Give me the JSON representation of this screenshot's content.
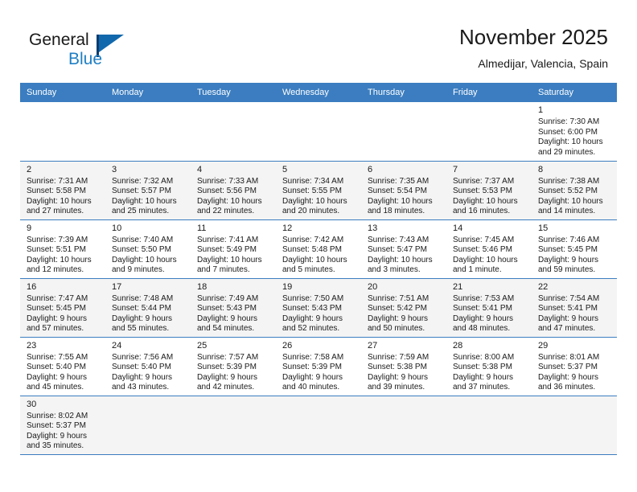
{
  "brand": {
    "name_part1": "General",
    "name_part2": "Blue",
    "logo_icon": "flag-triangle-icon"
  },
  "header": {
    "title": "November 2025",
    "subtitle": "Almedijar, Valencia, Spain"
  },
  "colors": {
    "header_blue": "#3b7dc0",
    "brand_blue": "#1f7fc4",
    "alt_row": "#f4f4f4",
    "text": "#1a1a1a"
  },
  "weekday_headers": [
    "Sunday",
    "Monday",
    "Tuesday",
    "Wednesday",
    "Thursday",
    "Friday",
    "Saturday"
  ],
  "labels": {
    "sunrise_prefix": "Sunrise: ",
    "sunset_prefix": "Sunset: ",
    "daylight_prefix": "Daylight: "
  },
  "weeks": [
    {
      "alt": false,
      "days": [
        {
          "empty": true
        },
        {
          "empty": true
        },
        {
          "empty": true
        },
        {
          "empty": true
        },
        {
          "empty": true
        },
        {
          "empty": true
        },
        {
          "empty": false,
          "day": "1",
          "sunrise": "Sunrise: 7:30 AM",
          "sunset": "Sunset: 6:00 PM",
          "daylight_line1": "Daylight: 10 hours",
          "daylight_line2": "and 29 minutes."
        }
      ]
    },
    {
      "alt": true,
      "days": [
        {
          "empty": false,
          "day": "2",
          "sunrise": "Sunrise: 7:31 AM",
          "sunset": "Sunset: 5:58 PM",
          "daylight_line1": "Daylight: 10 hours",
          "daylight_line2": "and 27 minutes."
        },
        {
          "empty": false,
          "day": "3",
          "sunrise": "Sunrise: 7:32 AM",
          "sunset": "Sunset: 5:57 PM",
          "daylight_line1": "Daylight: 10 hours",
          "daylight_line2": "and 25 minutes."
        },
        {
          "empty": false,
          "day": "4",
          "sunrise": "Sunrise: 7:33 AM",
          "sunset": "Sunset: 5:56 PM",
          "daylight_line1": "Daylight: 10 hours",
          "daylight_line2": "and 22 minutes."
        },
        {
          "empty": false,
          "day": "5",
          "sunrise": "Sunrise: 7:34 AM",
          "sunset": "Sunset: 5:55 PM",
          "daylight_line1": "Daylight: 10 hours",
          "daylight_line2": "and 20 minutes."
        },
        {
          "empty": false,
          "day": "6",
          "sunrise": "Sunrise: 7:35 AM",
          "sunset": "Sunset: 5:54 PM",
          "daylight_line1": "Daylight: 10 hours",
          "daylight_line2": "and 18 minutes."
        },
        {
          "empty": false,
          "day": "7",
          "sunrise": "Sunrise: 7:37 AM",
          "sunset": "Sunset: 5:53 PM",
          "daylight_line1": "Daylight: 10 hours",
          "daylight_line2": "and 16 minutes."
        },
        {
          "empty": false,
          "day": "8",
          "sunrise": "Sunrise: 7:38 AM",
          "sunset": "Sunset: 5:52 PM",
          "daylight_line1": "Daylight: 10 hours",
          "daylight_line2": "and 14 minutes."
        }
      ]
    },
    {
      "alt": false,
      "days": [
        {
          "empty": false,
          "day": "9",
          "sunrise": "Sunrise: 7:39 AM",
          "sunset": "Sunset: 5:51 PM",
          "daylight_line1": "Daylight: 10 hours",
          "daylight_line2": "and 12 minutes."
        },
        {
          "empty": false,
          "day": "10",
          "sunrise": "Sunrise: 7:40 AM",
          "sunset": "Sunset: 5:50 PM",
          "daylight_line1": "Daylight: 10 hours",
          "daylight_line2": "and 9 minutes."
        },
        {
          "empty": false,
          "day": "11",
          "sunrise": "Sunrise: 7:41 AM",
          "sunset": "Sunset: 5:49 PM",
          "daylight_line1": "Daylight: 10 hours",
          "daylight_line2": "and 7 minutes."
        },
        {
          "empty": false,
          "day": "12",
          "sunrise": "Sunrise: 7:42 AM",
          "sunset": "Sunset: 5:48 PM",
          "daylight_line1": "Daylight: 10 hours",
          "daylight_line2": "and 5 minutes."
        },
        {
          "empty": false,
          "day": "13",
          "sunrise": "Sunrise: 7:43 AM",
          "sunset": "Sunset: 5:47 PM",
          "daylight_line1": "Daylight: 10 hours",
          "daylight_line2": "and 3 minutes."
        },
        {
          "empty": false,
          "day": "14",
          "sunrise": "Sunrise: 7:45 AM",
          "sunset": "Sunset: 5:46 PM",
          "daylight_line1": "Daylight: 10 hours",
          "daylight_line2": "and 1 minute."
        },
        {
          "empty": false,
          "day": "15",
          "sunrise": "Sunrise: 7:46 AM",
          "sunset": "Sunset: 5:45 PM",
          "daylight_line1": "Daylight: 9 hours",
          "daylight_line2": "and 59 minutes."
        }
      ]
    },
    {
      "alt": true,
      "days": [
        {
          "empty": false,
          "day": "16",
          "sunrise": "Sunrise: 7:47 AM",
          "sunset": "Sunset: 5:45 PM",
          "daylight_line1": "Daylight: 9 hours",
          "daylight_line2": "and 57 minutes."
        },
        {
          "empty": false,
          "day": "17",
          "sunrise": "Sunrise: 7:48 AM",
          "sunset": "Sunset: 5:44 PM",
          "daylight_line1": "Daylight: 9 hours",
          "daylight_line2": "and 55 minutes."
        },
        {
          "empty": false,
          "day": "18",
          "sunrise": "Sunrise: 7:49 AM",
          "sunset": "Sunset: 5:43 PM",
          "daylight_line1": "Daylight: 9 hours",
          "daylight_line2": "and 54 minutes."
        },
        {
          "empty": false,
          "day": "19",
          "sunrise": "Sunrise: 7:50 AM",
          "sunset": "Sunset: 5:43 PM",
          "daylight_line1": "Daylight: 9 hours",
          "daylight_line2": "and 52 minutes."
        },
        {
          "empty": false,
          "day": "20",
          "sunrise": "Sunrise: 7:51 AM",
          "sunset": "Sunset: 5:42 PM",
          "daylight_line1": "Daylight: 9 hours",
          "daylight_line2": "and 50 minutes."
        },
        {
          "empty": false,
          "day": "21",
          "sunrise": "Sunrise: 7:53 AM",
          "sunset": "Sunset: 5:41 PM",
          "daylight_line1": "Daylight: 9 hours",
          "daylight_line2": "and 48 minutes."
        },
        {
          "empty": false,
          "day": "22",
          "sunrise": "Sunrise: 7:54 AM",
          "sunset": "Sunset: 5:41 PM",
          "daylight_line1": "Daylight: 9 hours",
          "daylight_line2": "and 47 minutes."
        }
      ]
    },
    {
      "alt": false,
      "days": [
        {
          "empty": false,
          "day": "23",
          "sunrise": "Sunrise: 7:55 AM",
          "sunset": "Sunset: 5:40 PM",
          "daylight_line1": "Daylight: 9 hours",
          "daylight_line2": "and 45 minutes."
        },
        {
          "empty": false,
          "day": "24",
          "sunrise": "Sunrise: 7:56 AM",
          "sunset": "Sunset: 5:40 PM",
          "daylight_line1": "Daylight: 9 hours",
          "daylight_line2": "and 43 minutes."
        },
        {
          "empty": false,
          "day": "25",
          "sunrise": "Sunrise: 7:57 AM",
          "sunset": "Sunset: 5:39 PM",
          "daylight_line1": "Daylight: 9 hours",
          "daylight_line2": "and 42 minutes."
        },
        {
          "empty": false,
          "day": "26",
          "sunrise": "Sunrise: 7:58 AM",
          "sunset": "Sunset: 5:39 PM",
          "daylight_line1": "Daylight: 9 hours",
          "daylight_line2": "and 40 minutes."
        },
        {
          "empty": false,
          "day": "27",
          "sunrise": "Sunrise: 7:59 AM",
          "sunset": "Sunset: 5:38 PM",
          "daylight_line1": "Daylight: 9 hours",
          "daylight_line2": "and 39 minutes."
        },
        {
          "empty": false,
          "day": "28",
          "sunrise": "Sunrise: 8:00 AM",
          "sunset": "Sunset: 5:38 PM",
          "daylight_line1": "Daylight: 9 hours",
          "daylight_line2": "and 37 minutes."
        },
        {
          "empty": false,
          "day": "29",
          "sunrise": "Sunrise: 8:01 AM",
          "sunset": "Sunset: 5:37 PM",
          "daylight_line1": "Daylight: 9 hours",
          "daylight_line2": "and 36 minutes."
        }
      ]
    },
    {
      "alt": true,
      "days": [
        {
          "empty": false,
          "day": "30",
          "sunrise": "Sunrise: 8:02 AM",
          "sunset": "Sunset: 5:37 PM",
          "daylight_line1": "Daylight: 9 hours",
          "daylight_line2": "and 35 minutes."
        },
        {
          "empty": true
        },
        {
          "empty": true
        },
        {
          "empty": true
        },
        {
          "empty": true
        },
        {
          "empty": true
        },
        {
          "empty": true
        }
      ]
    }
  ]
}
